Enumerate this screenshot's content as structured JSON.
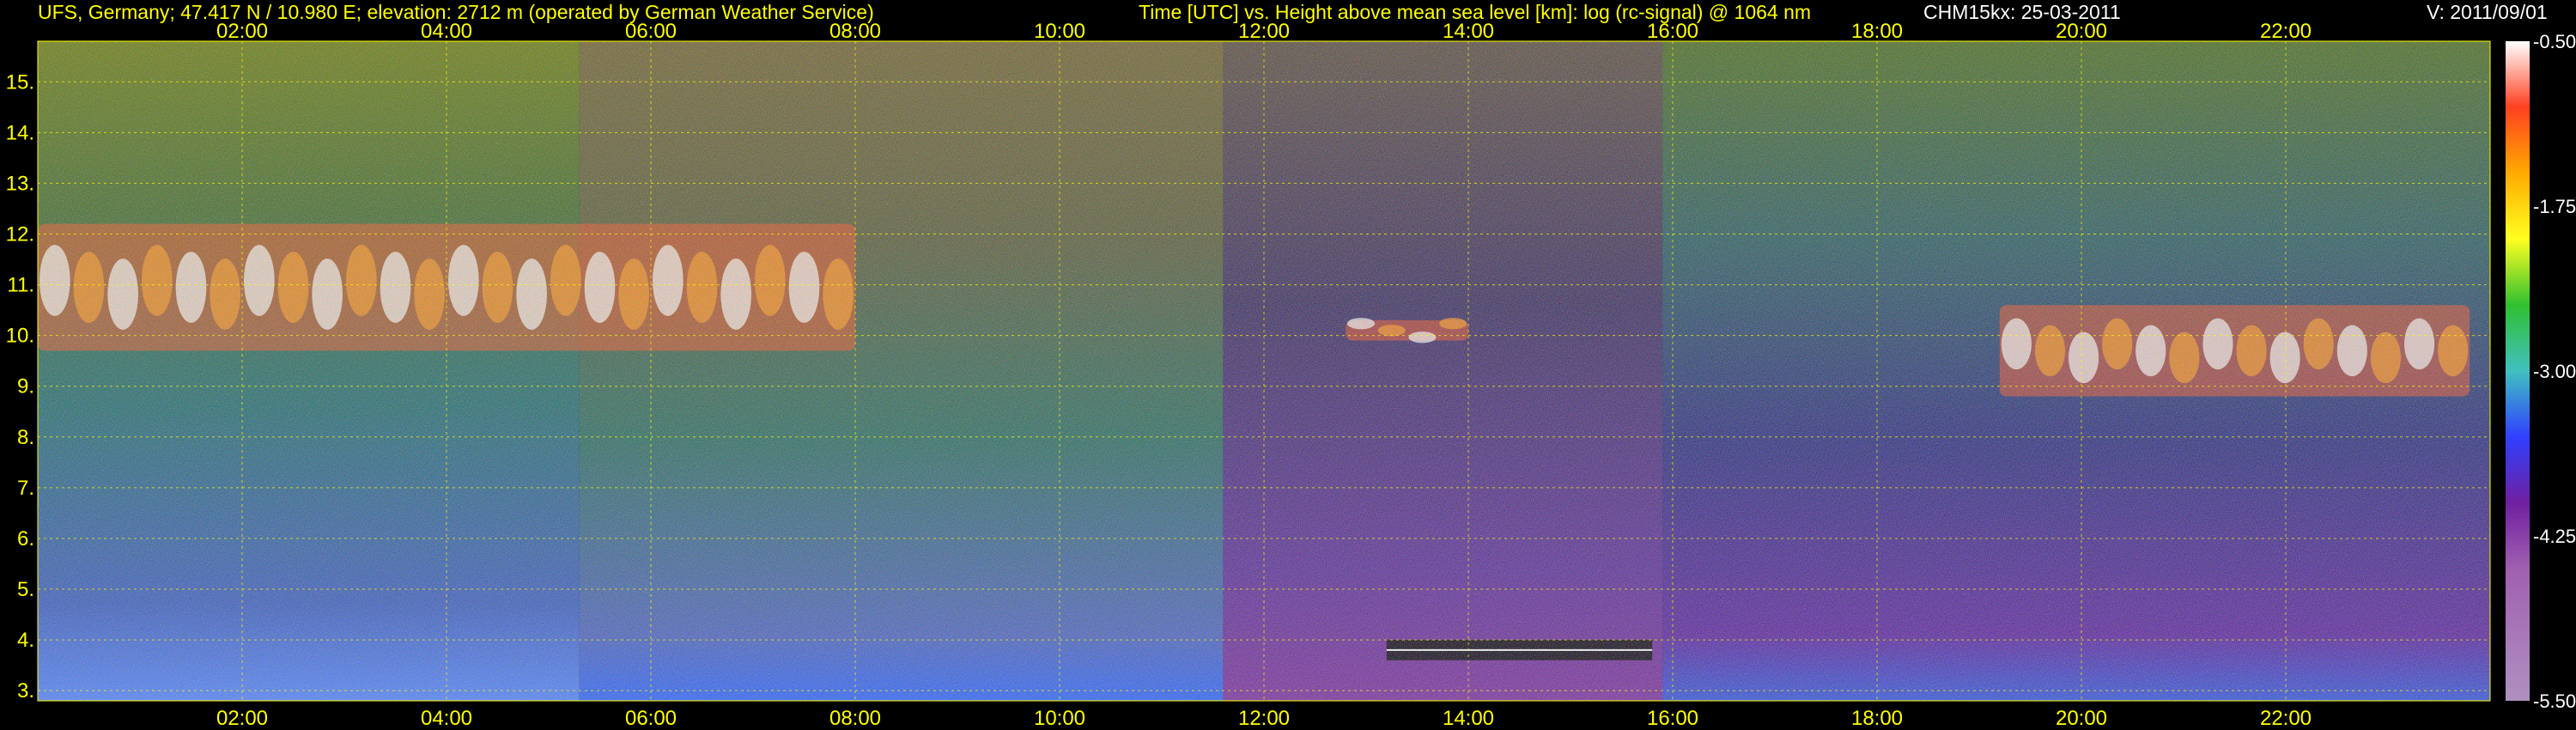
{
  "header": {
    "station": "UFS, Germany; 47.417 N / 10.980 E; elevation: 2712 m  (operated by German Weather Service)",
    "plot_title": "Time [UTC] vs. Height above mean sea level [km]: log (rc-signal) @ 1064 nm",
    "instrument_date": "CHM15kx: 25-03-2011",
    "version": "V: 2011/09/01"
  },
  "chart_data": {
    "type": "heatmap",
    "title": "Time [UTC] vs. Height above mean sea level [km]: log (rc-signal) @ 1064 nm",
    "x_ticks": [
      "02:00",
      "04:00",
      "06:00",
      "08:00",
      "10:00",
      "12:00",
      "14:00",
      "16:00",
      "18:00",
      "20:00",
      "22:00"
    ],
    "x_tick_hours": [
      2,
      4,
      6,
      8,
      10,
      12,
      14,
      16,
      18,
      20,
      22
    ],
    "xlim_hours": [
      0,
      24
    ],
    "y_ticks": [
      3,
      4,
      5,
      6,
      7,
      8,
      9,
      10,
      11,
      12,
      13,
      14,
      15
    ],
    "y_tick_labels": [
      "3.",
      "4.",
      "5.",
      "6.",
      "7.",
      "8.",
      "9.",
      "10.",
      "11.",
      "12.",
      "13.",
      "14.",
      "15."
    ],
    "ylim_km": [
      2.8,
      15.8
    ],
    "grid": true,
    "colorbar": {
      "ticks": [
        -0.5,
        -1.75,
        -3.0,
        -4.25,
        -5.5
      ],
      "labels": [
        "-0.50",
        "-1.75",
        "-3.00",
        "-4.25",
        "-5.50"
      ],
      "range": [
        -5.5,
        -0.5
      ]
    },
    "features": [
      {
        "kind": "cirrus",
        "t": [
          0.0,
          8.0
        ],
        "z": [
          9.7,
          12.2
        ]
      },
      {
        "kind": "cirrus",
        "t": [
          12.8,
          14.0
        ],
        "z": [
          9.9,
          10.3
        ]
      },
      {
        "kind": "cirrus",
        "t": [
          19.2,
          23.8
        ],
        "z": [
          8.8,
          10.6
        ]
      },
      {
        "kind": "low_cloud",
        "t": [
          13.2,
          15.8
        ],
        "z": [
          3.6,
          4.0
        ]
      }
    ]
  }
}
